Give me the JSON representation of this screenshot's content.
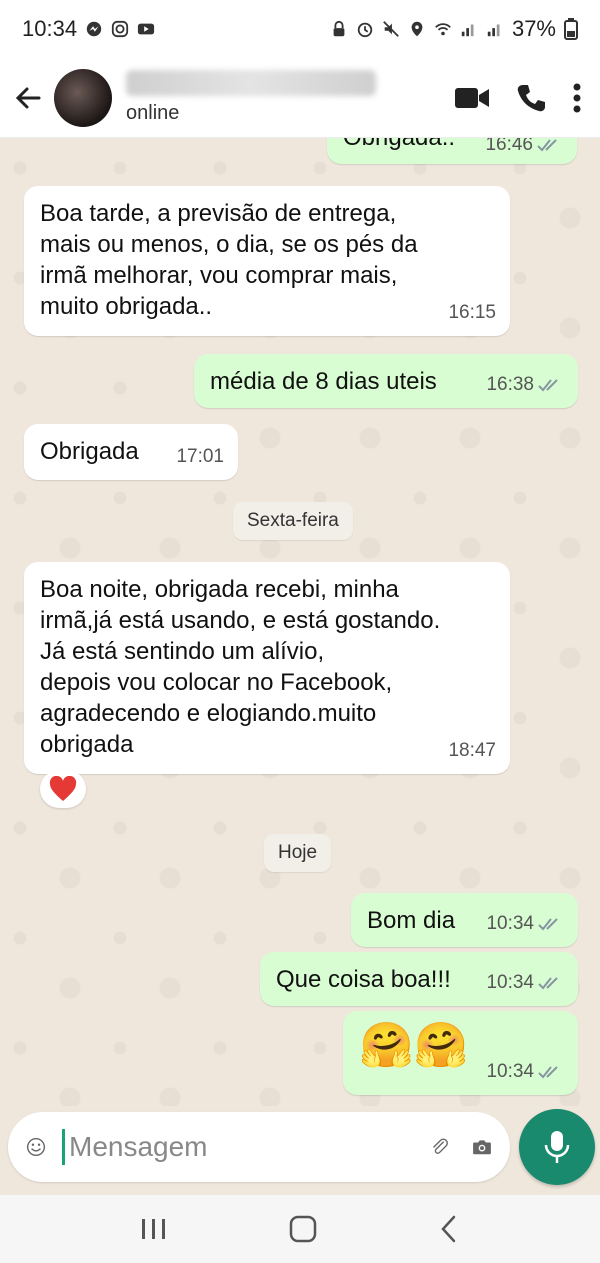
{
  "status_bar": {
    "time": "10:34",
    "battery": "37%"
  },
  "header": {
    "status": "online",
    "icons": [
      "back-arrow-icon",
      "video-call-icon",
      "phone-icon",
      "more-vert-icon"
    ]
  },
  "messages": [
    {
      "id": "m0",
      "direction": "out",
      "text": "Obrigada..",
      "time": "16:46",
      "read": true
    },
    {
      "id": "m1",
      "direction": "in",
      "text": "Boa tarde, a previsão de entrega,\nmais ou menos, o dia, se os pés da\nirmã melhorar, vou comprar mais,\nmuito obrigada..",
      "time": "16:15"
    },
    {
      "id": "m2",
      "direction": "out",
      "text": "média de 8 dias uteis",
      "time": "16:38",
      "read": true
    },
    {
      "id": "m3",
      "direction": "in",
      "text": "Obrigada",
      "time": "17:01"
    },
    {
      "id": "m4",
      "direction": "in",
      "text": "Boa noite, obrigada recebi, minha\nirmã,já está usando, e está gostando.\nJá está sentindo um alívio,\ndepois vou colocar no Facebook,\nagradecendo e elogiando.muito\nobrigada",
      "time": "18:47",
      "reaction": "❤️"
    },
    {
      "id": "m5",
      "direction": "out",
      "text": "Bom dia",
      "time": "10:34",
      "read": true
    },
    {
      "id": "m6",
      "direction": "out",
      "text": "Que coisa boa!!!",
      "time": "10:34",
      "read": true
    },
    {
      "id": "m7",
      "direction": "out",
      "text": "🤗🤗",
      "time": "10:34",
      "read": true
    }
  ],
  "date_chips": [
    "Sexta-feira",
    "Hoje"
  ],
  "input": {
    "placeholder": "Mensagem",
    "icons": [
      "emoji-icon",
      "attach-icon",
      "camera-icon",
      "mic-icon"
    ]
  },
  "colors": {
    "outgoing_bubble": "#d9fdd3",
    "incoming_bubble": "#ffffff",
    "chat_background": "#efe7dc",
    "accent": "#1a8a6e",
    "read_ticks": "#8696a0"
  }
}
